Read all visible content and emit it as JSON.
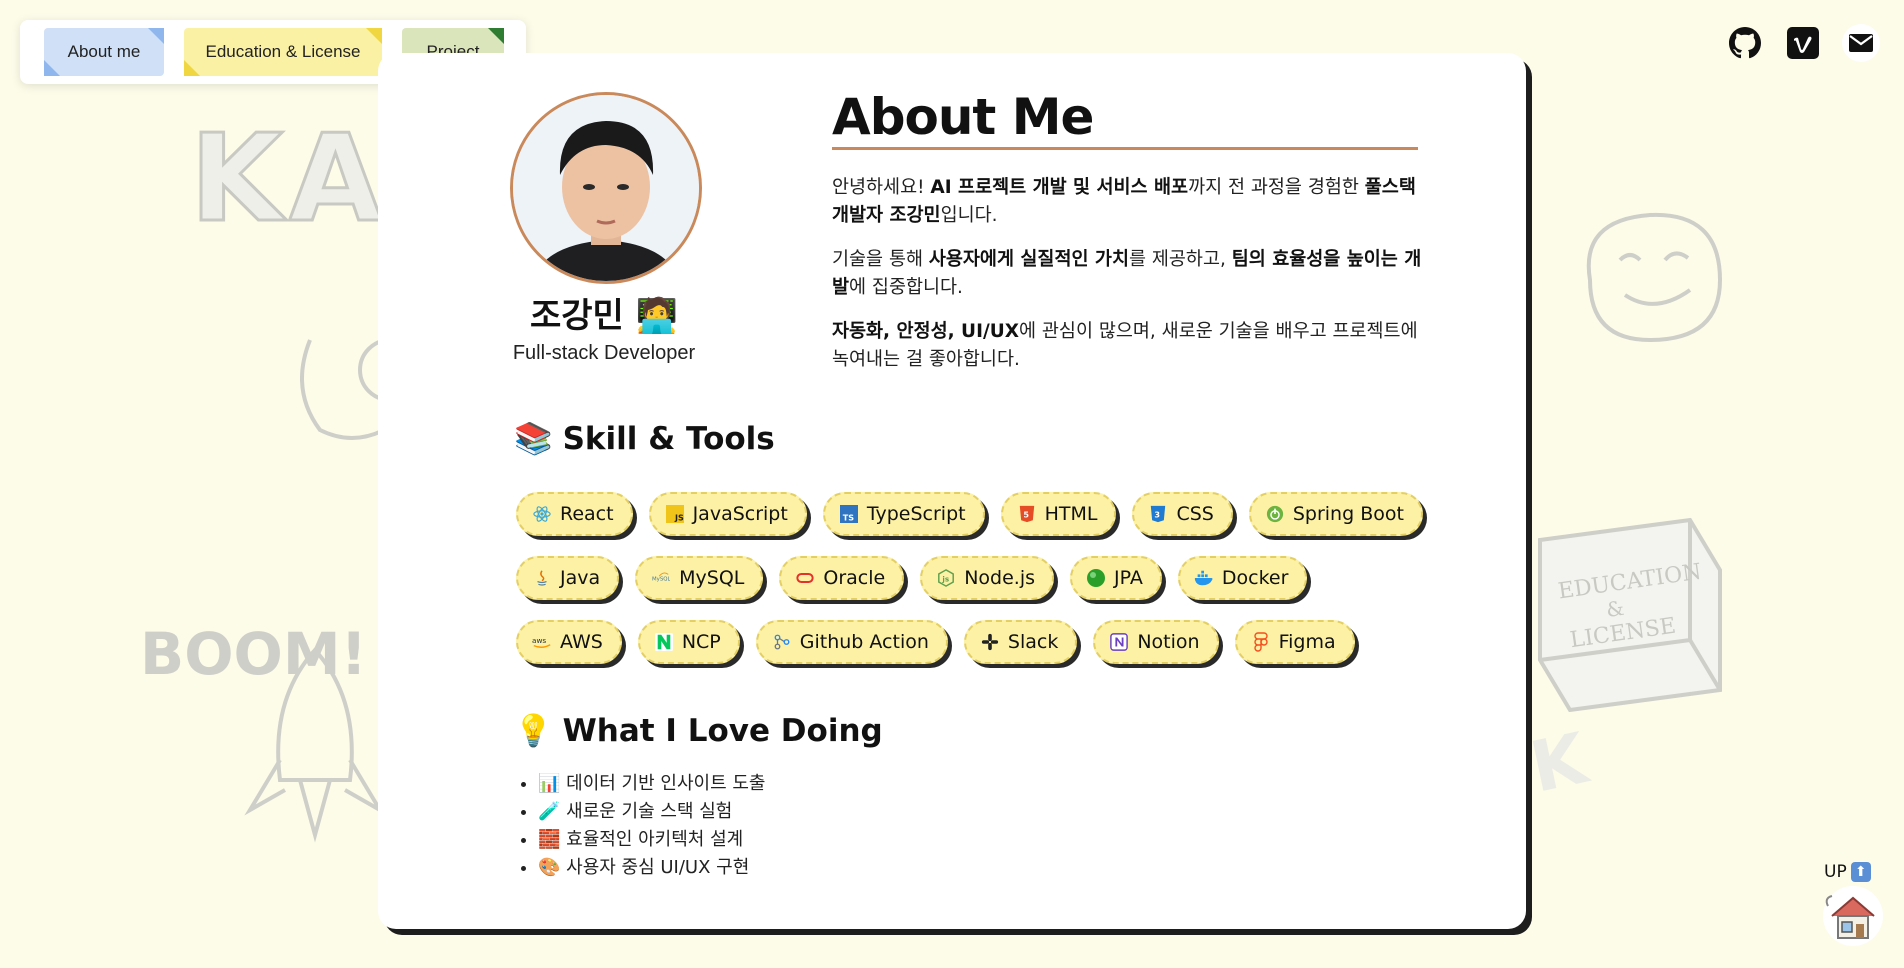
{
  "nav": {
    "tabs": [
      {
        "label": "About me"
      },
      {
        "label": "Education & License"
      },
      {
        "label": "Project"
      }
    ]
  },
  "social": [
    "github-icon",
    "vimeo-icon",
    "mail-icon"
  ],
  "profile": {
    "name": "조강민",
    "name_emoji": "🧑‍💻",
    "role": "Full-stack Developer"
  },
  "about": {
    "title": "About Me",
    "p1": [
      {
        "t": "안녕하세요! ",
        "b": false
      },
      {
        "t": "AI 프로젝트 개발 및 서비스 배포",
        "b": true
      },
      {
        "t": "까지 전 과정을 경험한 ",
        "b": false
      },
      {
        "t": "풀스택 개발자 조강민",
        "b": true
      },
      {
        "t": "입니다.",
        "b": false
      }
    ],
    "p2": [
      {
        "t": "기술을 통해 ",
        "b": false
      },
      {
        "t": "사용자에게 실질적인 가치",
        "b": true
      },
      {
        "t": "를 제공하고, ",
        "b": false
      },
      {
        "t": "팀의 효율성을 높이는 개발",
        "b": true
      },
      {
        "t": "에 집중합니다.",
        "b": false
      }
    ],
    "p3": [
      {
        "t": "자동화, 안정성, UI/UX",
        "b": true
      },
      {
        "t": "에 관심이 많으며, 새로운 기술을 배우고 프로젝트에 녹여내는 걸 좋아합니다.",
        "b": false
      }
    ]
  },
  "skills": {
    "emoji": "📚",
    "title": "Skill & Tools",
    "rows": [
      [
        {
          "label": "React",
          "icon": "react-icon",
          "color": "#3aa8d8"
        },
        {
          "label": "JavaScript",
          "icon": "javascript-icon",
          "color": "#f0c419"
        },
        {
          "label": "TypeScript",
          "icon": "typescript-icon",
          "color": "#2f74c0"
        },
        {
          "label": "HTML",
          "icon": "html-icon",
          "color": "#e44d26"
        },
        {
          "label": "CSS",
          "icon": "css-icon",
          "color": "#1f7ad1"
        },
        {
          "label": "Spring Boot",
          "icon": "spring-boot-icon",
          "color": "#6db33f"
        }
      ],
      [
        {
          "label": "Java",
          "icon": "java-icon",
          "color": "#e76f00"
        },
        {
          "label": "MySQL",
          "icon": "mysql-icon",
          "color": "#4479a1"
        },
        {
          "label": "Oracle",
          "icon": "oracle-icon",
          "color": "#e4322b"
        },
        {
          "label": "Node.js",
          "icon": "nodejs-icon",
          "color": "#5fa04e"
        },
        {
          "label": "JPA",
          "icon": "jpa-icon",
          "color": "#2aa02a"
        },
        {
          "label": "Docker",
          "icon": "docker-icon",
          "color": "#2496ed"
        }
      ],
      [
        {
          "label": "AWS",
          "icon": "aws-icon",
          "color": "#ff9900"
        },
        {
          "label": "NCP",
          "icon": "ncp-icon",
          "color": "#03c75a"
        },
        {
          "label": "Github Action",
          "icon": "github-action-icon",
          "color": "#2088ff"
        },
        {
          "label": "Slack",
          "icon": "slack-icon",
          "color": "#222222"
        },
        {
          "label": "Notion",
          "icon": "notion-icon",
          "color": "#6b3fc2"
        },
        {
          "label": "Figma",
          "icon": "figma-icon",
          "color": "#f24e1e"
        }
      ]
    ]
  },
  "love": {
    "emoji": "💡",
    "title": "What I Love Doing",
    "items": [
      {
        "emoji": "📊",
        "text": "데이터 기반 인사이트 도출"
      },
      {
        "emoji": "🧪",
        "text": "새로운 기술 스택 실험"
      },
      {
        "emoji": "🧱",
        "text": "효율적인 아키텍처 설계"
      },
      {
        "emoji": "🎨",
        "text": "사용자 중심 UI/UX 구현"
      }
    ]
  },
  "up": {
    "label": "UP"
  }
}
